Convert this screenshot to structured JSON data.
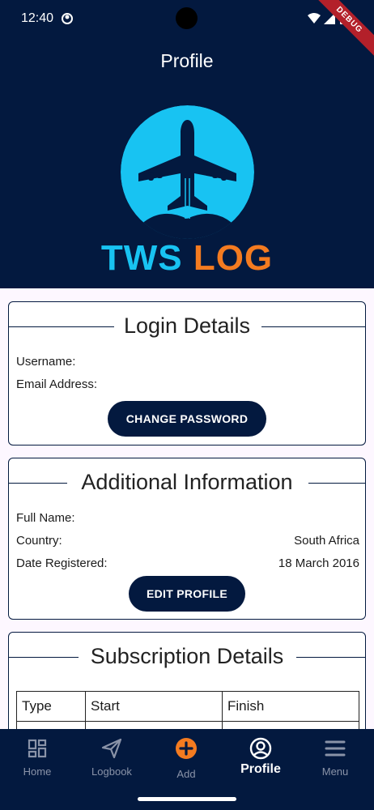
{
  "status_bar": {
    "time": "12:40",
    "debug_label": "DEBUG"
  },
  "header": {
    "title": "Profile",
    "logo": {
      "word1": "TWS",
      "word2": "LOG",
      "colors": {
        "primary_blue": "#18c3f2",
        "orange": "#f47b20",
        "navy": "#03193f"
      }
    }
  },
  "login_details": {
    "title": "Login Details",
    "username_label": "Username:",
    "username_value": "",
    "email_label": "Email Address:",
    "email_value": "",
    "change_password_button": "CHANGE PASSWORD"
  },
  "additional_information": {
    "title": "Additional Information",
    "full_name_label": "Full Name:",
    "full_name_value": "",
    "country_label": "Country:",
    "country_value": "South Africa",
    "date_registered_label": "Date Registered:",
    "date_registered_value": "18 March 2016",
    "edit_profile_button": "EDIT PROFILE"
  },
  "subscription_details": {
    "title": "Subscription Details",
    "columns": [
      "Type",
      "Start",
      "Finish"
    ]
  },
  "bottom_nav": {
    "items": [
      {
        "label": "Home",
        "icon": "dashboard-icon"
      },
      {
        "label": "Logbook",
        "icon": "send-icon"
      },
      {
        "label": "Add",
        "icon": "add-circle-icon"
      },
      {
        "label": "Profile",
        "icon": "account-circle-icon",
        "active": true
      },
      {
        "label": "Menu",
        "icon": "hamburger-menu-icon"
      }
    ],
    "add_color": "#f47b20"
  }
}
